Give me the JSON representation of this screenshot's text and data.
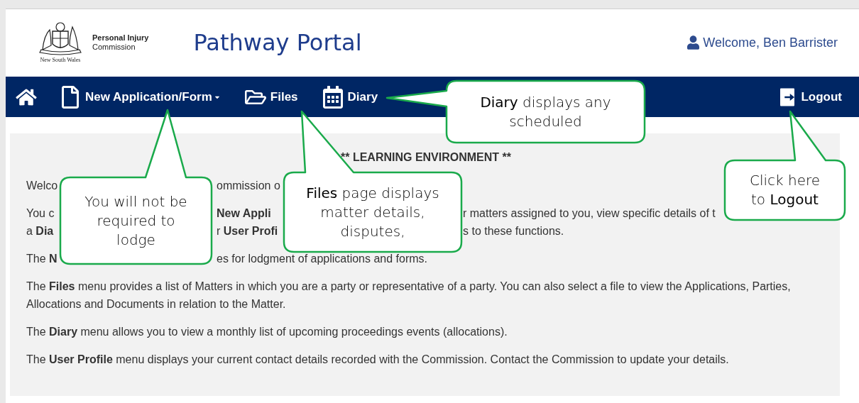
{
  "header": {
    "logo_caption": "New South Wales",
    "org_line_1": "Personal Injury",
    "org_line_2": "Commission",
    "title": "Pathway Portal",
    "welcome": "Welcome, Ben Barrister"
  },
  "nav": {
    "items": [
      {
        "kind": "home"
      },
      {
        "kind": "file",
        "label": "New Application/Form",
        "dropdown": true
      },
      {
        "kind": "folder",
        "label": "Files",
        "dropdown": false
      },
      {
        "kind": "calendar",
        "label": "Diary",
        "dropdown": false
      }
    ],
    "logout": "Logout"
  },
  "content": {
    "heading": "** LEARNING ENVIRONMENT **",
    "partial_paragraphs": [
      [
        [
          "Welco",
          "ommission o"
        ]
      ],
      [
        [
          "You c",
          "**New Appli**",
          "r matters assigned to you, view specific details of t"
        ],
        [
          "a **Dia**",
          "r **User Profi**",
          "s to these functions."
        ]
      ],
      [
        [
          "The **N**",
          "es for lodgment of applications and forms."
        ]
      ]
    ],
    "paragraphs": [
      "The **Files** menu provides a list of Matters in which you are a party or representative of a party.  You can also select a file to view the Applications, Parties, Allocations and Documents in relation to the Matter.",
      "The **Diary** menu allows you to view a monthly list of upcoming proceedings events (allocations).",
      "The **User Profile** menu displays your current contact details recorded with the Commission.  Contact the Commission to update your details."
    ]
  },
  "callouts": [
    "You will not be required to lodge",
    "**Files** page displays matter details, disputes,",
    "**Diary** displays any scheduled",
    "Click here to **Logout**"
  ]
}
